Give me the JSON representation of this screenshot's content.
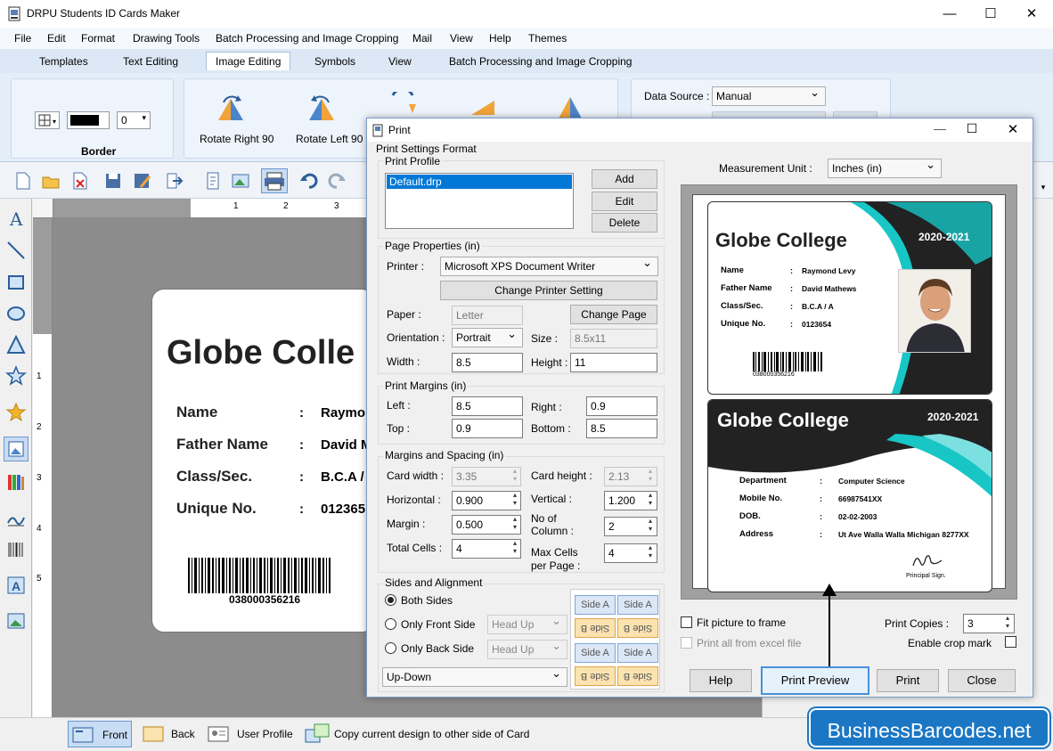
{
  "window": {
    "title": "DRPU Students ID Cards Maker",
    "minimize": "—",
    "maximize": "☐",
    "close": "✕"
  },
  "menubar": [
    "File",
    "Edit",
    "Format",
    "Drawing Tools",
    "Batch Processing and Image Cropping",
    "Mail",
    "View",
    "Help",
    "Themes"
  ],
  "ribbon_tabs": [
    "Templates",
    "Text Editing",
    "Image Editing",
    "Symbols",
    "View",
    "Batch Processing and Image Cropping"
  ],
  "ribbon": {
    "border_group": "Border",
    "border_width": "0",
    "rotate_right": "Rotate Right 90",
    "rotate_left": "Rotate Left 90",
    "data_source_label": "Data Source :",
    "data_source_value": "Manual"
  },
  "card": {
    "college": "Globe Colle",
    "fields": [
      {
        "k": "Name",
        "v": "Raymo"
      },
      {
        "k": "Father Name",
        "v": "David M"
      },
      {
        "k": "Class/Sec.",
        "v": "B.C.A /"
      },
      {
        "k": "Unique No.",
        "v": "012365"
      }
    ],
    "barcode": "038000356216"
  },
  "rulers": {
    "h": [
      "1",
      "2",
      "3"
    ],
    "v": [
      "1",
      "2",
      "3",
      "4",
      "5"
    ]
  },
  "bottom": {
    "front": "Front",
    "back": "Back",
    "user_profile": "User Profile",
    "copy": "Copy current design to other side of Card"
  },
  "watermark": "BusinessBarcodes.net",
  "dialog": {
    "title": "Print",
    "print_settings": "Print Settings Format",
    "print_profile": "Print Profile",
    "profile_item": "Default.drp",
    "add": "Add",
    "edit": "Edit",
    "delete": "Delete",
    "page_properties": "Page Properties  (in)",
    "printer_label": "Printer :",
    "printer_value": "Microsoft XPS Document Writer",
    "change_printer": "Change Printer Setting",
    "paper_label": "Paper :",
    "paper_value": "Letter",
    "change_page": "Change Page",
    "orientation_label": "Orientation :",
    "orientation_value": "Portrait",
    "size_label": "Size :",
    "size_value": "8.5x11",
    "width_label": "Width :",
    "width_value": "8.5",
    "height_label": "Height :",
    "height_value": "11",
    "print_margins": "Print Margins (in)",
    "left_label": "Left :",
    "left_value": "8.5",
    "right_label": "Right :",
    "right_value": "0.9",
    "top_label": "Top :",
    "top_value": "0.9",
    "bottom_label": "Bottom :",
    "bottom_value": "8.5",
    "margins_spacing": "Margins and Spacing  (in)",
    "card_width_label": "Card width :",
    "card_width_value": "3.35",
    "card_height_label": "Card height :",
    "card_height_value": "2.13",
    "horizontal_label": "Horizontal :",
    "horizontal_value": "0.900",
    "vertical_label": "Vertical :",
    "vertical_value": "1.200",
    "margin_label": "Margin :",
    "margin_value": "0.500",
    "no_of_column_label1": "No of",
    "no_of_column_label2": "Column :",
    "no_of_column_value": "2",
    "total_cells_label": "Total Cells :",
    "total_cells_value": "4",
    "max_cells_label1": "Max Cells",
    "max_cells_label2": "per Page :",
    "max_cells_value": "4",
    "sides_alignment": "Sides and Alignment",
    "both_sides": "Both Sides",
    "only_front": "Only Front Side",
    "only_back": "Only Back Side",
    "head_up": "Head Up",
    "updown": "Up-Down",
    "side_a": "Side A",
    "side_b": "Side B",
    "measurement_label": "Measurement Unit :",
    "measurement_value": "Inches (in)",
    "fit_picture": "Fit picture to frame",
    "print_all_excel": "Print all from excel file",
    "print_copies_label": "Print Copies :",
    "print_copies_value": "3",
    "enable_crop": "Enable crop mark",
    "help": "Help",
    "print_preview": "Print Preview",
    "print": "Print",
    "close": "Close"
  },
  "preview": {
    "front": {
      "college": "Globe College",
      "year": "2020-2021",
      "fields": [
        {
          "k": "Name",
          "v": "Raymond Levy"
        },
        {
          "k": "Father Name",
          "v": "David Mathews"
        },
        {
          "k": "Class/Sec.",
          "v": "B.C.A / A"
        },
        {
          "k": "Unique No.",
          "v": "0123654"
        }
      ],
      "barcode": "038000356216"
    },
    "back": {
      "college": "Globe College",
      "year": "2020-2021",
      "fields": [
        {
          "k": "Department",
          "v": "Computer Science"
        },
        {
          "k": "Mobile No.",
          "v": "66987541XX"
        },
        {
          "k": "DOB.",
          "v": "02-02-2003"
        },
        {
          "k": "Address",
          "v": "Ut Ave Walla Walla Michigan 8277XX"
        }
      ],
      "signature_label": "Principal Sign."
    }
  },
  "colors": {
    "teal": "#18c6c6",
    "dark": "#222222",
    "accent": "#1b77c4"
  }
}
